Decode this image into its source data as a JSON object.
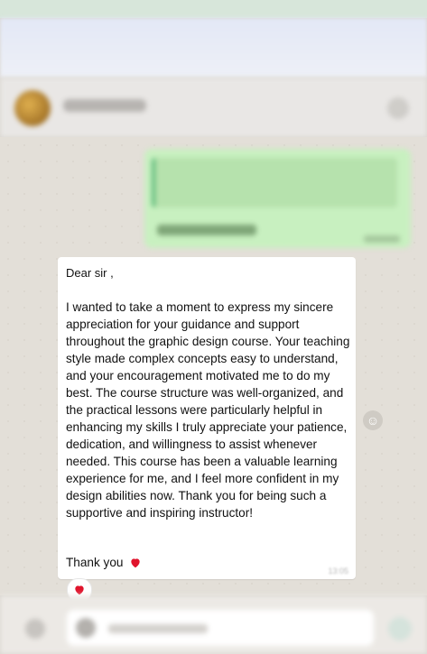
{
  "message": {
    "greeting": "Dear sir ,",
    "body": "I wanted to take a moment to express my sincere appreciation for your guidance and support throughout the graphic design course. Your teaching style made complex concepts easy to understand, and your encouragement motivated me to do my best. The course structure was well-organized, and the practical lessons were particularly helpful in enhancing my skills I truly appreciate your patience, dedication, and willingness to assist whenever needed. This course has been a valuable learning experience for me, and I feel more confident in my design abilities now. Thank you for being such a supportive and inspiring instructor!",
    "closing": "Thank you",
    "closing_emoji": "red-heart-icon",
    "time": "13:05",
    "reaction": "red-heart-icon"
  },
  "outgoing_message": {
    "text": "Plz consider this"
  },
  "colors": {
    "chat_background": "#e3dfd8",
    "incoming_bubble": "#ffffff",
    "outgoing_bubble": "#c8f0c0",
    "heart": "#e0142c"
  }
}
